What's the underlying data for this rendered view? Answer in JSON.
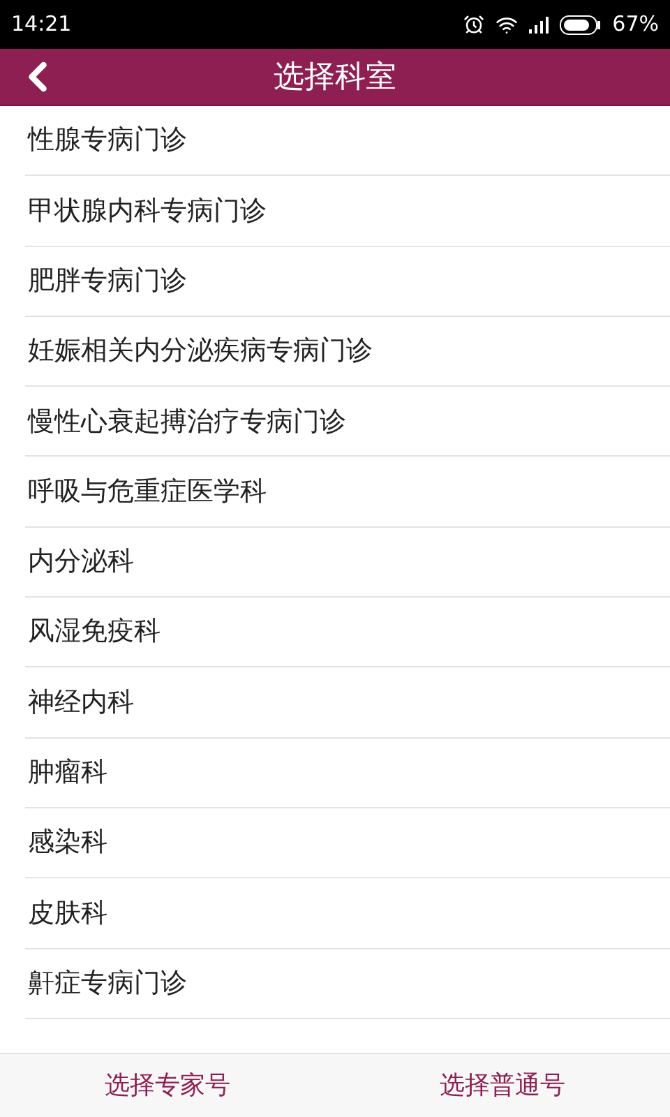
{
  "status_bar": {
    "time": "14:21",
    "battery": "67%"
  },
  "header": {
    "title": "选择科室"
  },
  "departments": [
    "性腺专病门诊",
    "甲状腺内科专病门诊",
    "肥胖专病门诊",
    "妊娠相关内分泌疾病专病门诊",
    "慢性心衰起搏治疗专病门诊",
    "呼吸与危重症医学科",
    "内分泌科",
    "风湿免疫科",
    "神经内科",
    "肿瘤科",
    "感染科",
    "皮肤科",
    "鼾症专病门诊"
  ],
  "bottom_bar": [
    "选择专家号",
    "选择普通号"
  ]
}
